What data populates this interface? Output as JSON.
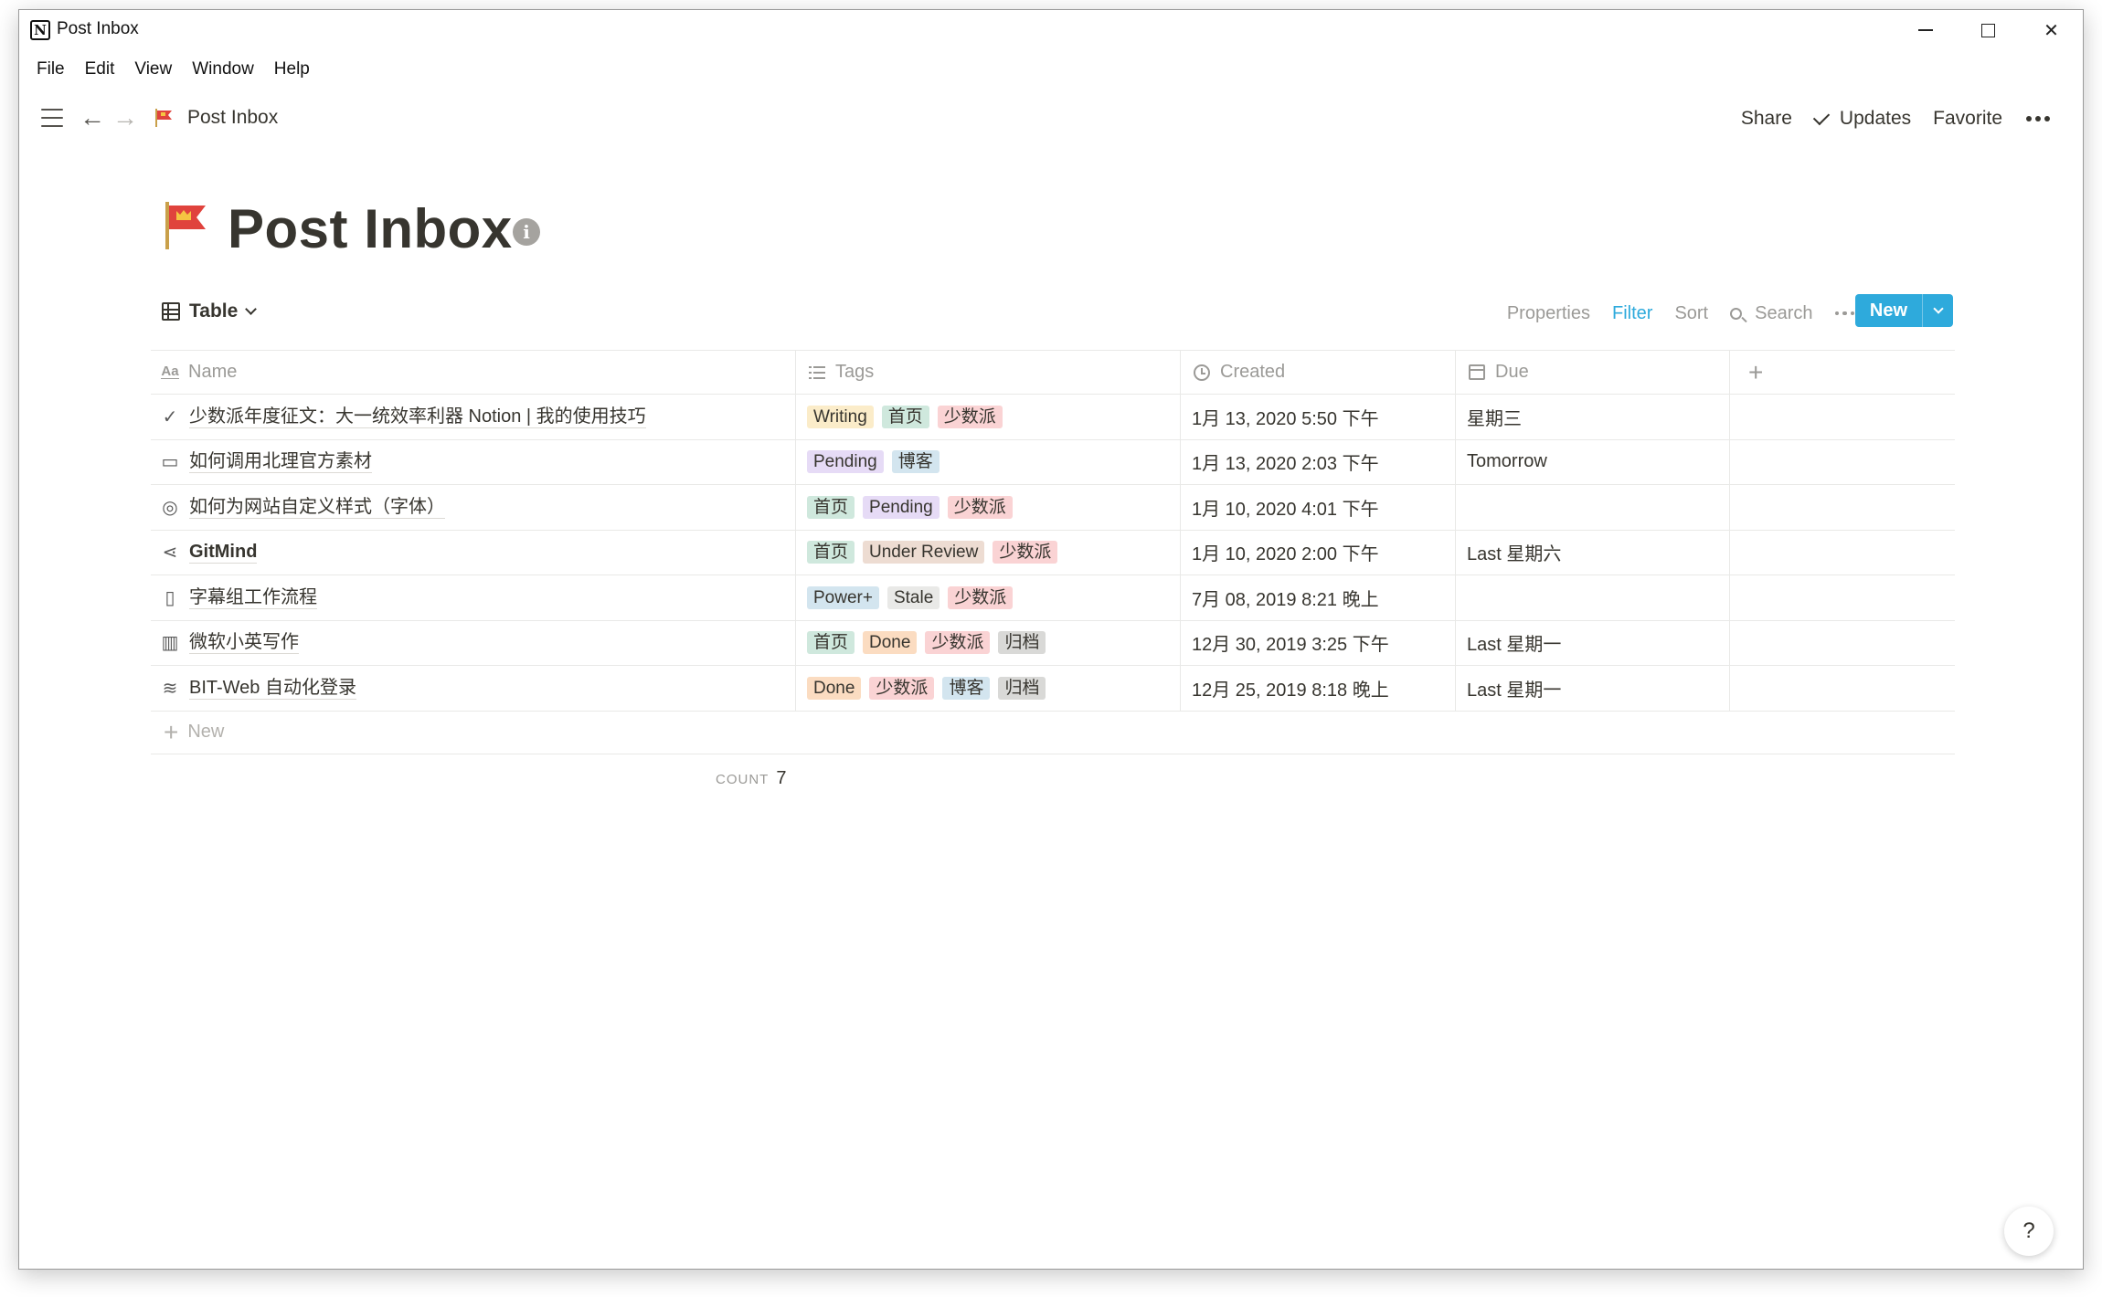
{
  "window": {
    "title": "Post Inbox",
    "app_icon": "N"
  },
  "menu": [
    "File",
    "Edit",
    "View",
    "Window",
    "Help"
  ],
  "topbar": {
    "breadcrumb": "Post Inbox",
    "share": "Share",
    "updates": "Updates",
    "favorite": "Favorite"
  },
  "page": {
    "title": "Post Inbox",
    "icon": "red-flag-icon",
    "info": "i"
  },
  "view": {
    "name": "Table",
    "properties": "Properties",
    "filter": "Filter",
    "sort": "Sort",
    "search": "Search",
    "new_label": "New"
  },
  "columns": [
    "Name",
    "Tags",
    "Created",
    "Due"
  ],
  "rows": [
    {
      "icon": "check-circle-icon",
      "glyph": "✓",
      "name": "少数派年度征文：大一统效率利器 Notion | 我的使用技巧",
      "bold": false,
      "tags": [
        {
          "label": "Writing",
          "cls": "t-writing"
        },
        {
          "label": "首页",
          "cls": "t-home"
        },
        {
          "label": "少数派",
          "cls": "t-sspai"
        }
      ],
      "created": "1月 13, 2020 5:50 下午",
      "due": "星期三"
    },
    {
      "icon": "archive-icon",
      "glyph": "▭",
      "name": "如何调用北理官方素材",
      "bold": false,
      "tags": [
        {
          "label": "Pending",
          "cls": "t-pending"
        },
        {
          "label": "博客",
          "cls": "t-blog"
        }
      ],
      "created": "1月 13, 2020 2:03 下午",
      "due": "Tomorrow"
    },
    {
      "icon": "palette-icon",
      "glyph": "◎",
      "name": "如何为网站自定义样式（字体）",
      "bold": false,
      "tags": [
        {
          "label": "首页",
          "cls": "t-home"
        },
        {
          "label": "Pending",
          "cls": "t-pending"
        },
        {
          "label": "少数派",
          "cls": "t-sspai"
        }
      ],
      "created": "1月 10, 2020 4:01 下午",
      "due": ""
    },
    {
      "icon": "share-icon",
      "glyph": "⋖",
      "name": "GitMind",
      "bold": true,
      "tags": [
        {
          "label": "首页",
          "cls": "t-home"
        },
        {
          "label": "Under Review",
          "cls": "t-review"
        },
        {
          "label": "少数派",
          "cls": "t-sspai"
        }
      ],
      "created": "1月 10, 2020 2:00 下午",
      "due": "Last 星期六"
    },
    {
      "icon": "document-icon",
      "glyph": "▯",
      "name": "字幕组工作流程",
      "bold": false,
      "tags": [
        {
          "label": "Power+",
          "cls": "t-power"
        },
        {
          "label": "Stale",
          "cls": "t-stale"
        },
        {
          "label": "少数派",
          "cls": "t-sspai"
        }
      ],
      "created": "7月 08, 2019 8:21 晚上",
      "due": ""
    },
    {
      "icon": "map-icon",
      "glyph": "▥",
      "name": "微软小英写作",
      "bold": false,
      "tags": [
        {
          "label": "首页",
          "cls": "t-home"
        },
        {
          "label": "Done",
          "cls": "t-done"
        },
        {
          "label": "少数派",
          "cls": "t-sspai"
        },
        {
          "label": "归档",
          "cls": "t-archive"
        }
      ],
      "created": "12月 30, 2019 3:25 下午",
      "due": "Last 星期一"
    },
    {
      "icon": "wifi-icon",
      "glyph": "≋",
      "name": "BIT-Web 自动化登录",
      "bold": false,
      "tags": [
        {
          "label": "Done",
          "cls": "t-done"
        },
        {
          "label": "少数派",
          "cls": "t-sspai"
        },
        {
          "label": "博客",
          "cls": "t-blog"
        },
        {
          "label": "归档",
          "cls": "t-archive"
        }
      ],
      "created": "12月 25, 2019 8:18 晚上",
      "due": "Last 星期一"
    }
  ],
  "new_row_label": "New",
  "count": {
    "label": "COUNT",
    "value": "7"
  },
  "help": "?",
  "colors": {
    "accent": "#2eaadc",
    "text": "#37352f",
    "muted": "#9b9a97"
  }
}
